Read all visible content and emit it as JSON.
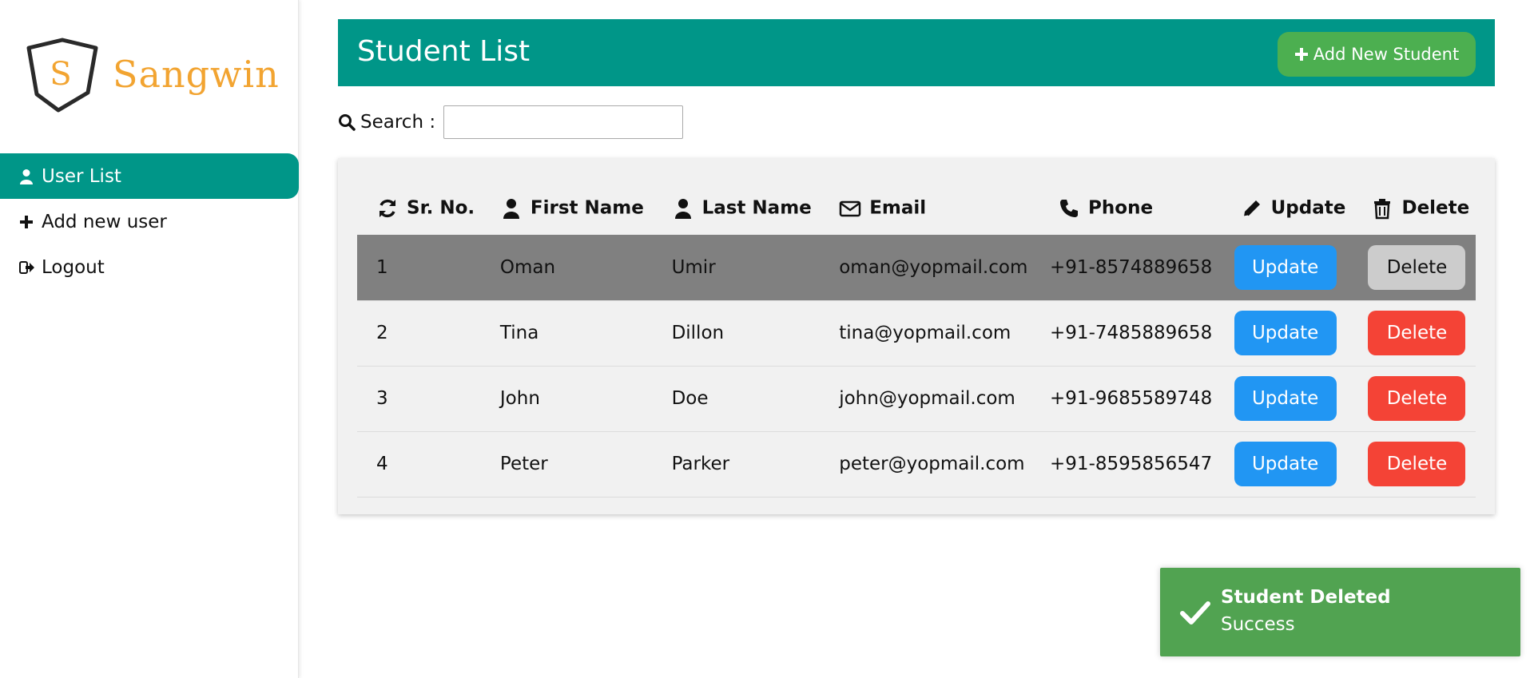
{
  "app": {
    "logo_letter": "S",
    "logo_name": "Sangwin",
    "accent_color": "#009688",
    "logo_color": "#f2a431"
  },
  "sidebar": {
    "items": [
      {
        "label": "User List",
        "icon": "user-icon",
        "active": true
      },
      {
        "label": "Add new user",
        "icon": "plus-icon",
        "active": false
      },
      {
        "label": "Logout",
        "icon": "logout-icon",
        "active": false
      }
    ]
  },
  "header": {
    "title": "Student List",
    "add_button_label": "Add New Student"
  },
  "search": {
    "label": "Search :",
    "value": "",
    "placeholder": ""
  },
  "table": {
    "columns": [
      {
        "label": "Sr. No.",
        "icon": "refresh-icon"
      },
      {
        "label": "First Name",
        "icon": "user-icon"
      },
      {
        "label": "Last Name",
        "icon": "user-icon"
      },
      {
        "label": "Email",
        "icon": "envelope-icon"
      },
      {
        "label": "Phone",
        "icon": "phone-icon"
      },
      {
        "label": "Update",
        "icon": "pencil-icon"
      },
      {
        "label": "Delete",
        "icon": "trash-icon"
      }
    ],
    "rows": [
      {
        "sr": "1",
        "first": "Oman",
        "last": "Umir",
        "email": "oman@yopmail.com",
        "phone": "+91-8574889658",
        "update": "Update",
        "delete": "Delete"
      },
      {
        "sr": "2",
        "first": "Tina",
        "last": "Dillon",
        "email": "tina@yopmail.com",
        "phone": "+91-7485889658",
        "update": "Update",
        "delete": "Delete"
      },
      {
        "sr": "3",
        "first": "John",
        "last": "Doe",
        "email": "john@yopmail.com",
        "phone": "+91-9685589748",
        "update": "Update",
        "delete": "Delete"
      },
      {
        "sr": "4",
        "first": "Peter",
        "last": "Parker",
        "email": "peter@yopmail.com",
        "phone": "+91-8595856547",
        "update": "Update",
        "delete": "Delete"
      }
    ],
    "update_color": "#2196f3",
    "delete_color": "#f44336"
  },
  "toast": {
    "title": "Student Deleted",
    "message": "Success",
    "color": "#51a351"
  }
}
